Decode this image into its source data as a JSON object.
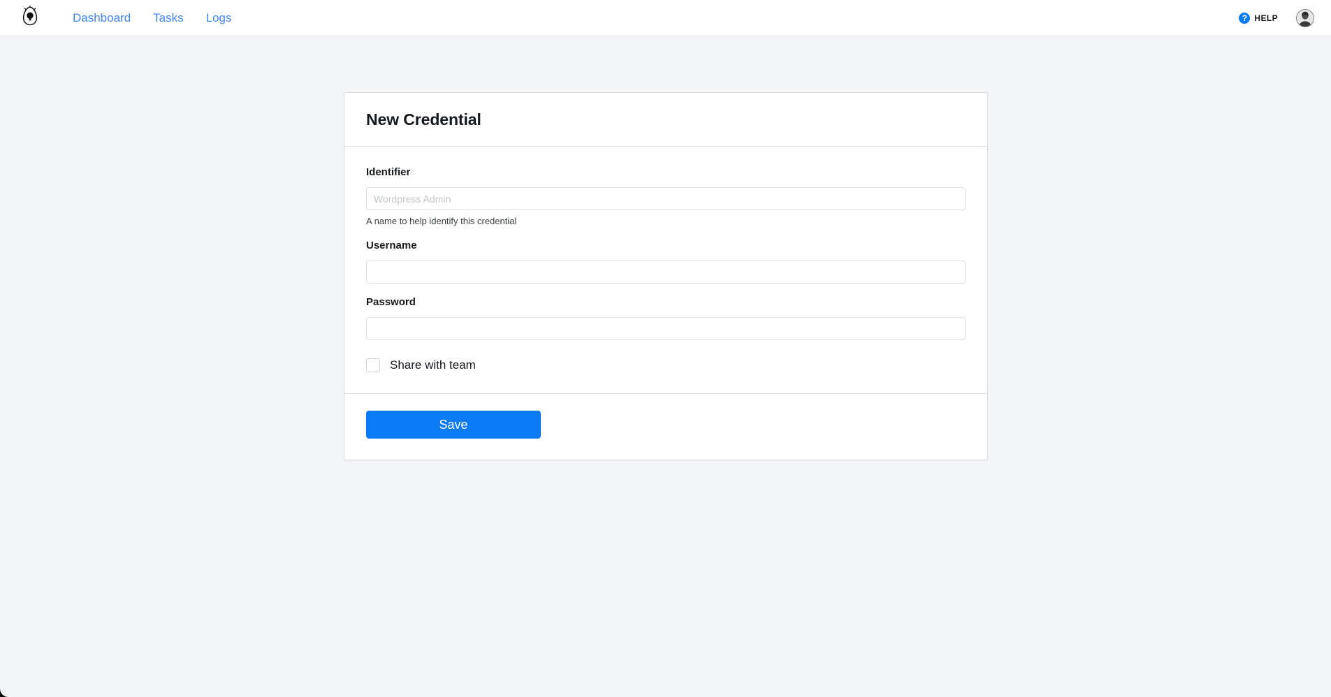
{
  "navbar": {
    "brand": {
      "icon": "egg-bird-logo"
    },
    "links": [
      {
        "label": "Dashboard",
        "name": "nav-link-dashboard"
      },
      {
        "label": "Tasks",
        "name": "nav-link-tasks"
      },
      {
        "label": "Logs",
        "name": "nav-link-logs"
      }
    ],
    "help": {
      "icon": "question-mark-icon",
      "glyph": "?",
      "label": "HELP"
    },
    "avatar": {
      "icon": "user-avatar"
    }
  },
  "card": {
    "title": "New Credential",
    "fields": {
      "identifier": {
        "label": "Identifier",
        "placeholder": "Wordpress Admin",
        "value": "",
        "hint": "A name to help identify this credential"
      },
      "username": {
        "label": "Username",
        "placeholder": "",
        "value": ""
      },
      "password": {
        "label": "Password",
        "placeholder": "",
        "value": ""
      }
    },
    "share_checkbox": {
      "label": "Share with team",
      "checked": false
    },
    "save_label": "Save"
  },
  "colors": {
    "accent_blue": "#0b7bf5",
    "link_blue": "#4285f4",
    "page_background": "#f4f5f7",
    "border": "#dcdfe3"
  }
}
